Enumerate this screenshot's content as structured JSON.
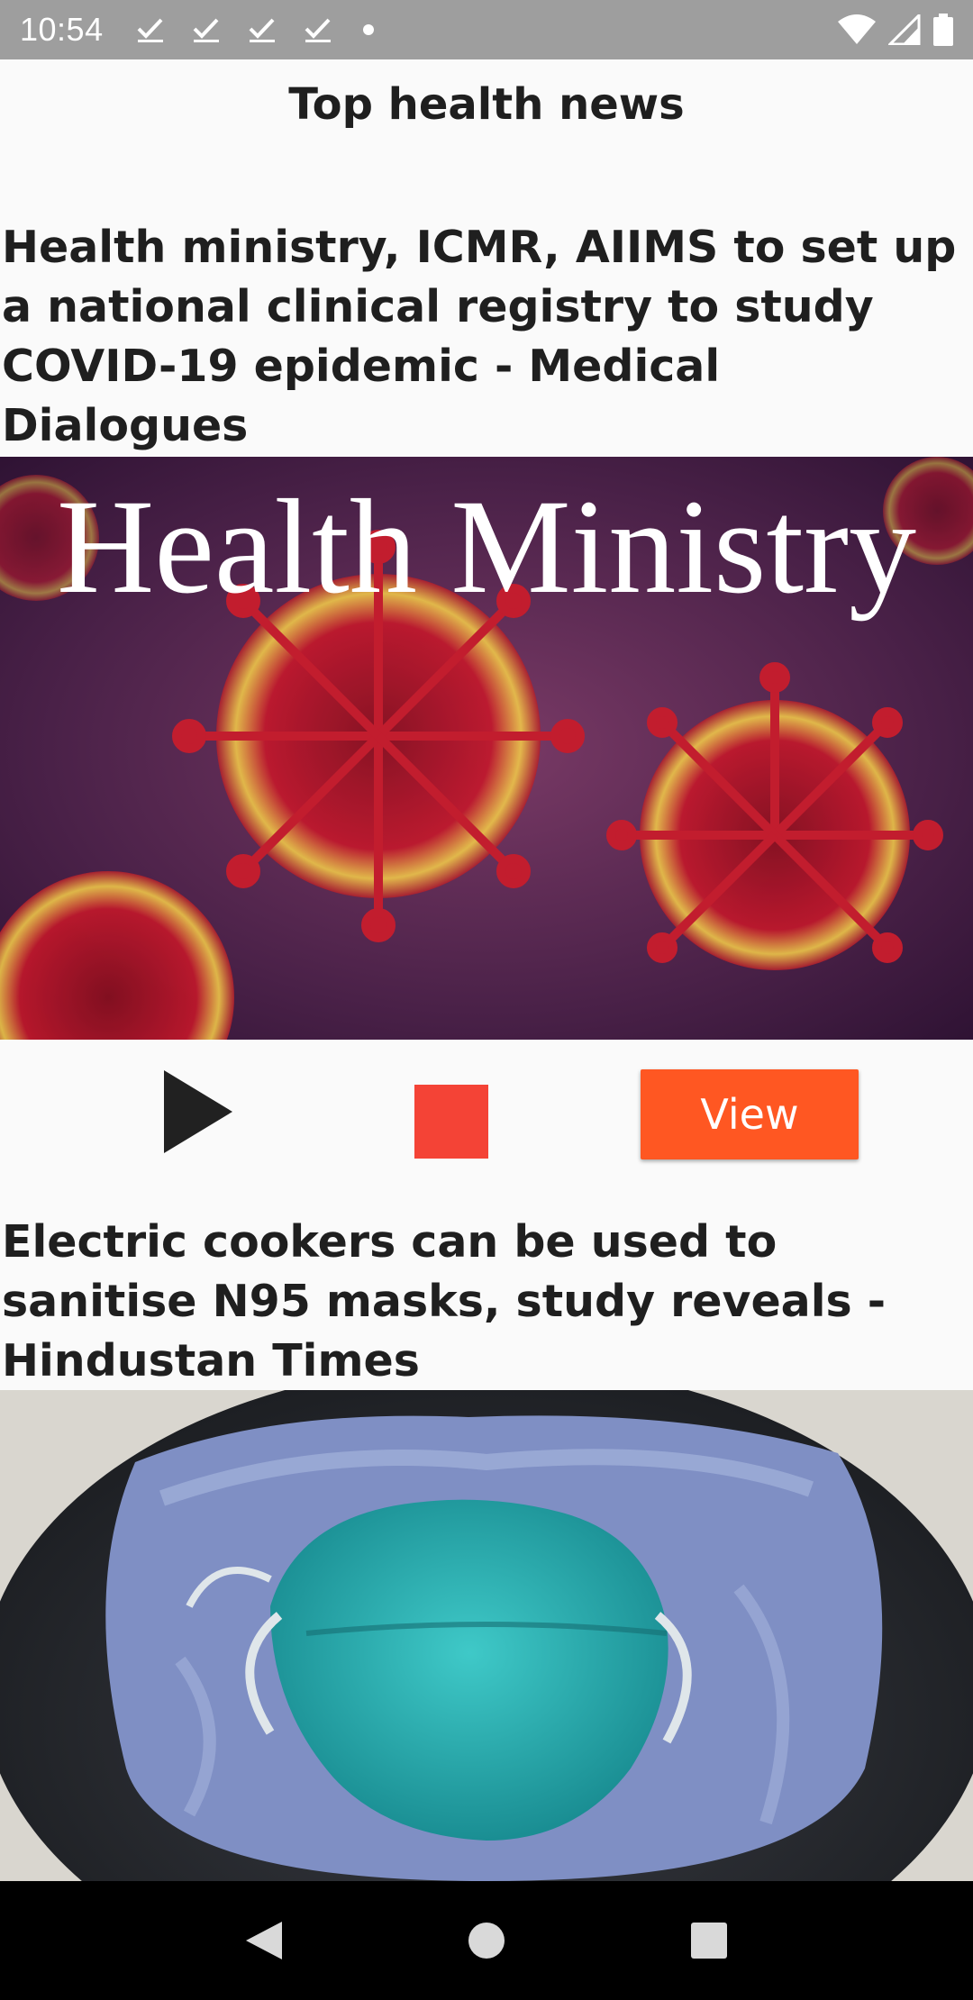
{
  "status_bar": {
    "time": "10:54",
    "notification_icons": [
      "check-download-icon",
      "check-download-icon",
      "check-download-icon",
      "check-download-icon",
      "dot-icon"
    ],
    "right_icons": [
      "wifi-icon",
      "signal-icon",
      "battery-icon"
    ]
  },
  "app": {
    "title": "Top health news"
  },
  "articles": [
    {
      "headline": "Health ministry, ICMR, AIIMS to set up a national clinical registry to study COVID-19 epidemic - Medical Dialogues",
      "image_text": "Health Ministry"
    },
    {
      "headline": "Electric cookers can be used to sanitise N95 masks, study reveals - Hindustan Times"
    }
  ],
  "actions": {
    "view_label": "View",
    "play_icon": "play-icon",
    "stop_icon": "stop-icon"
  },
  "nav_bar": {
    "icons": [
      "back-icon",
      "home-icon",
      "recents-icon"
    ]
  },
  "colors": {
    "status_bar": "#9e9e9e",
    "view_button": "#ff5722",
    "stop": "#f44336",
    "nav_bar": "#000000",
    "background": "#fafafa"
  }
}
